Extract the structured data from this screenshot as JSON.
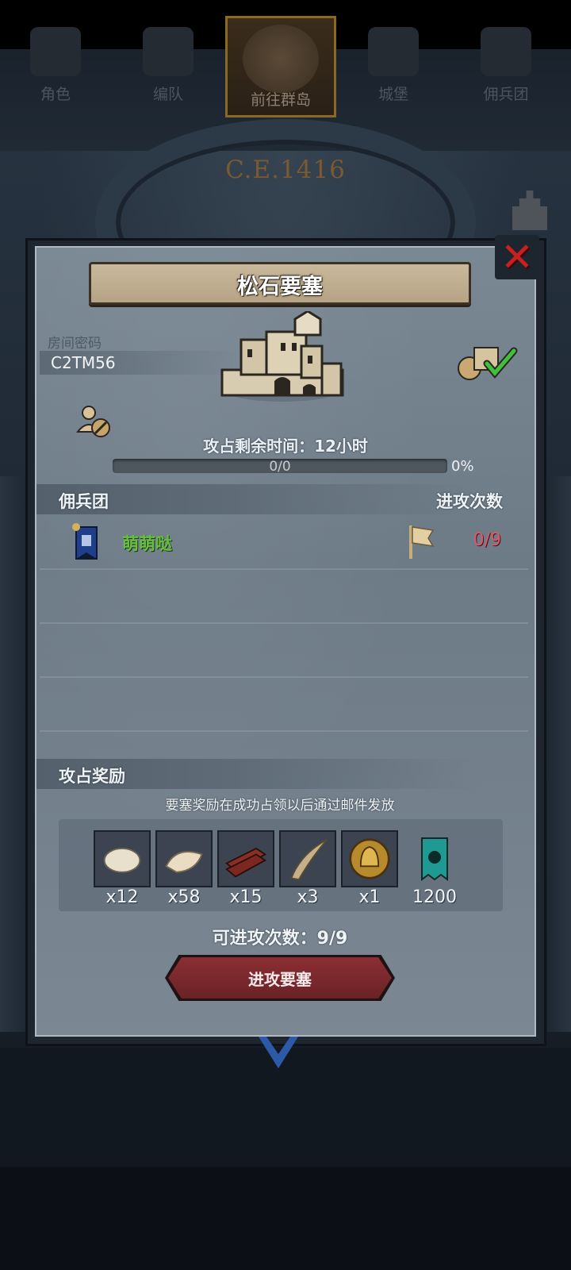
{
  "background": {
    "era": "C.E.1416"
  },
  "dialog": {
    "title": "松石要塞",
    "room_label": "房间密码",
    "room_code": "C2TM56",
    "time_remaining": "攻占剩余时间：12小时",
    "progress": {
      "text": "0/0",
      "percent": "0%",
      "fraction": 0
    },
    "mercenary_header": "佣兵团",
    "attack_count_header": "进攻次数",
    "rows": [
      {
        "guild": "萌萌哒",
        "attacks": "0/9"
      }
    ],
    "reward_header": "攻占奖励",
    "reward_note": "要塞奖励在成功占领以后通过邮件发放",
    "rewards": [
      {
        "item": "white-fur",
        "qty": "x12"
      },
      {
        "item": "pelt",
        "qty": "x58"
      },
      {
        "item": "wood-planks",
        "qty": "x15"
      },
      {
        "item": "horn",
        "qty": "x3"
      },
      {
        "item": "knight-helmet-medal",
        "qty": "x1"
      },
      {
        "item": "teal-guild-banner",
        "qty": "1200"
      }
    ],
    "attacks_available": "可进攻次数：9/9",
    "attack_button": "进攻要塞"
  },
  "nav": {
    "tabs": [
      {
        "label": "角色",
        "active": false
      },
      {
        "label": "编队",
        "active": false
      },
      {
        "label": "前往群岛",
        "active": true
      },
      {
        "label": "城堡",
        "active": false
      },
      {
        "label": "佣兵团",
        "active": false
      }
    ]
  },
  "colors": {
    "guild_name": "#66c040",
    "attack_count": "#e0576a",
    "close_x": "#c81f20",
    "button": "#7a282c"
  }
}
